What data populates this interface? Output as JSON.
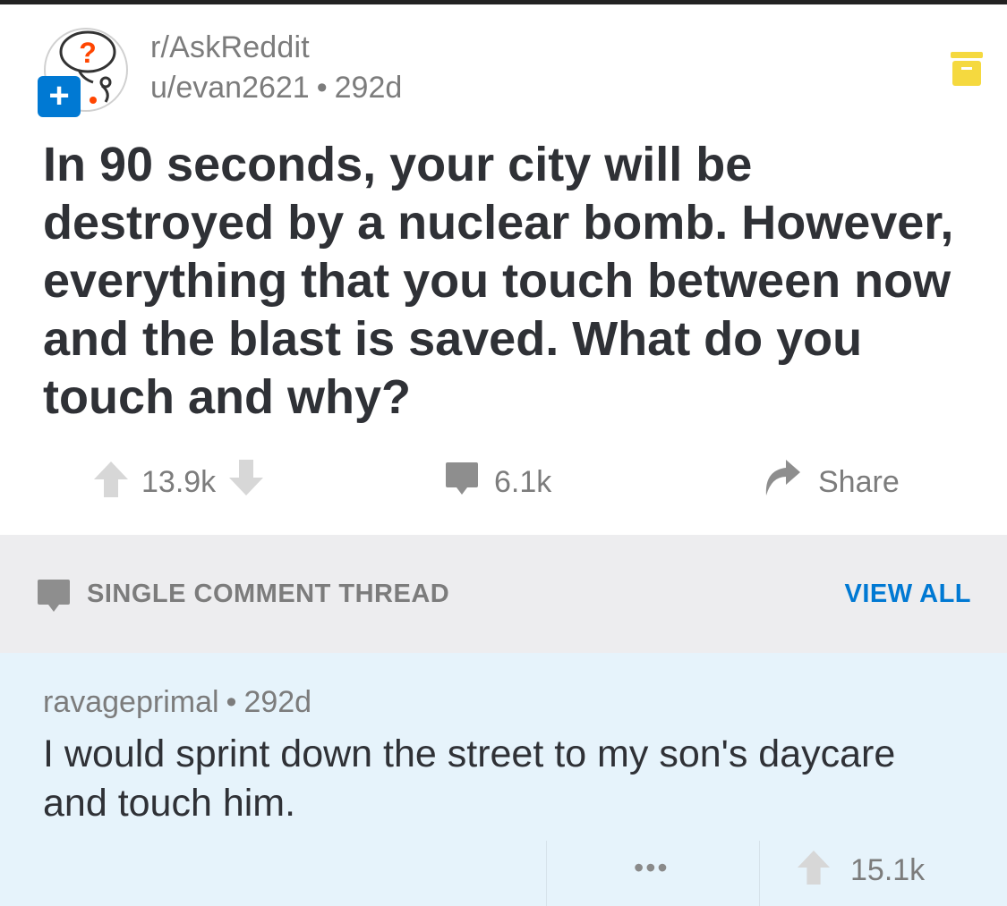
{
  "post": {
    "subreddit": "r/AskReddit",
    "author": "u/evan2621",
    "separator": "•",
    "age": "292d",
    "title": "In 90 seconds, your city will be destroyed by a nuclear bomb. However, everything that you touch between now and the blast is saved. What do you touch and why?",
    "upvotes": "13.9k",
    "comments": "6.1k",
    "share_label": "Share"
  },
  "thread": {
    "label": "SINGLE COMMENT THREAD",
    "view_all": "VIEW ALL"
  },
  "comment": {
    "author": "ravageprimal",
    "separator": "•",
    "age": "292d",
    "body": "I would sprint down the street to my son's daycare and touch him.",
    "more": "•••",
    "upvotes": "15.1k"
  },
  "colors": {
    "accent": "#0079d3",
    "save_icon": "#f5d93f",
    "thread_bar": "#ededef",
    "comment_bg": "#e6f3fb",
    "text_muted": "#7c7c7c",
    "text_main": "#2f3136"
  },
  "icons": {
    "avatar": "askreddit-icon",
    "plus": "plus-icon",
    "save": "save-icon",
    "upvote": "upvote-arrow-icon",
    "downvote": "downvote-arrow-icon",
    "comment": "comment-bubble-icon",
    "share": "share-arrow-icon",
    "more": "more-dots-icon"
  }
}
